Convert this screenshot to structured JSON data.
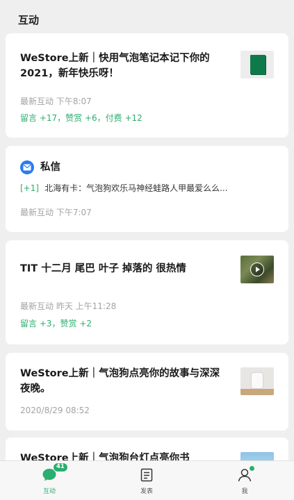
{
  "section": {
    "title": "互动"
  },
  "cards": [
    {
      "title": "WeStore上新｜快用气泡笔记本记下你的2021，新年快乐呀！",
      "time": "最新互动  下午8:07",
      "stats": "留言 +17，赞赏 +6，付费 +12",
      "thumb": "green-notebook-image"
    },
    {
      "message_title": "私信",
      "message_tag": "[+1]",
      "message_text": "北海有卡：气泡狗欢乐马神经蛙路人甲最爱么么...",
      "time": "最新互动  下午7:07",
      "icon": "mail-icon"
    },
    {
      "title": "TIT 十二月 尾巴 叶子 掉落的 很热情",
      "time": "最新互动 昨天 上午11:28",
      "stats": "留言 +3，赞赏 +2",
      "thumb": "video-thumbnail"
    },
    {
      "title": "WeStore上新｜气泡狗点亮你的故事与深深夜晚。",
      "time": "2020/8/29  08:52",
      "thumb": "product-image"
    },
    {
      "title": "WeStore上新｜气泡狗台灯点亮你书",
      "thumb": "sky-image"
    }
  ],
  "tabbar": {
    "tabs": [
      {
        "label": "互动",
        "icon": "chat-bubble-icon",
        "badge": "41",
        "active": true
      },
      {
        "label": "发表",
        "icon": "document-icon"
      },
      {
        "label": "我",
        "icon": "person-icon"
      }
    ]
  },
  "colors": {
    "accent": "#2bae6f",
    "mail": "#2a7bf3",
    "background": "#efefef"
  }
}
